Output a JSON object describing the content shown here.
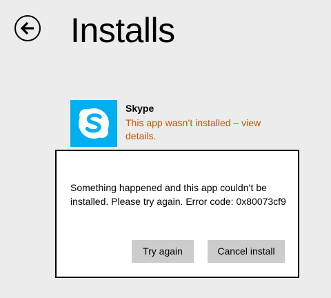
{
  "header": {
    "title": "Installs",
    "back_icon": "back-arrow-icon"
  },
  "install_item": {
    "app_name": "Skype",
    "app_icon": "skype-icon",
    "tile_color": "#00aff0",
    "status_text": "This app wasn’t installed – view details.",
    "status_color": "#d04f00"
  },
  "dialog": {
    "message": "Something happened and this app couldn’t be installed. Please try again. Error code: 0x80073cf9",
    "try_again_label": "Try again",
    "cancel_label": "Cancel install"
  }
}
